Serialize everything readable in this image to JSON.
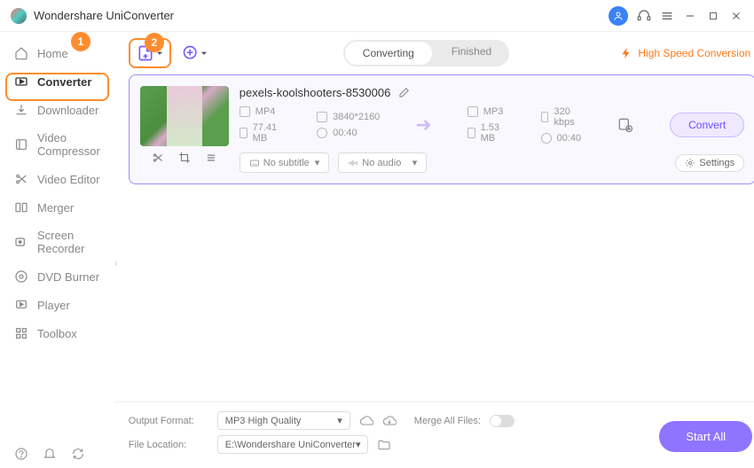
{
  "app": {
    "title": "Wondershare UniConverter"
  },
  "callouts": {
    "one": "1",
    "two": "2"
  },
  "sidebar": {
    "items": [
      {
        "label": "Home"
      },
      {
        "label": "Converter"
      },
      {
        "label": "Downloader"
      },
      {
        "label": "Video Compressor"
      },
      {
        "label": "Video Editor"
      },
      {
        "label": "Merger"
      },
      {
        "label": "Screen Recorder"
      },
      {
        "label": "DVD Burner"
      },
      {
        "label": "Player"
      },
      {
        "label": "Toolbox"
      }
    ]
  },
  "tabs": {
    "converting": "Converting",
    "finished": "Finished"
  },
  "hsc": "High Speed Conversion",
  "file": {
    "name": "pexels-koolshooters-8530006",
    "src": {
      "format": "MP4",
      "resolution": "3840*2160",
      "size": "77.41 MB",
      "duration": "00:40"
    },
    "dst": {
      "format": "MP3",
      "bitrate": "320 kbps",
      "size": "1.53 MB",
      "duration": "00:40"
    },
    "subtitle": "No subtitle",
    "audio": "No audio",
    "settings": "Settings",
    "convert": "Convert"
  },
  "footer": {
    "outputFormatLabel": "Output Format:",
    "outputFormat": "MP3 High Quality",
    "fileLocationLabel": "File Location:",
    "fileLocation": "E:\\Wondershare UniConverter",
    "mergeLabel": "Merge All Files:",
    "startAll": "Start All"
  }
}
